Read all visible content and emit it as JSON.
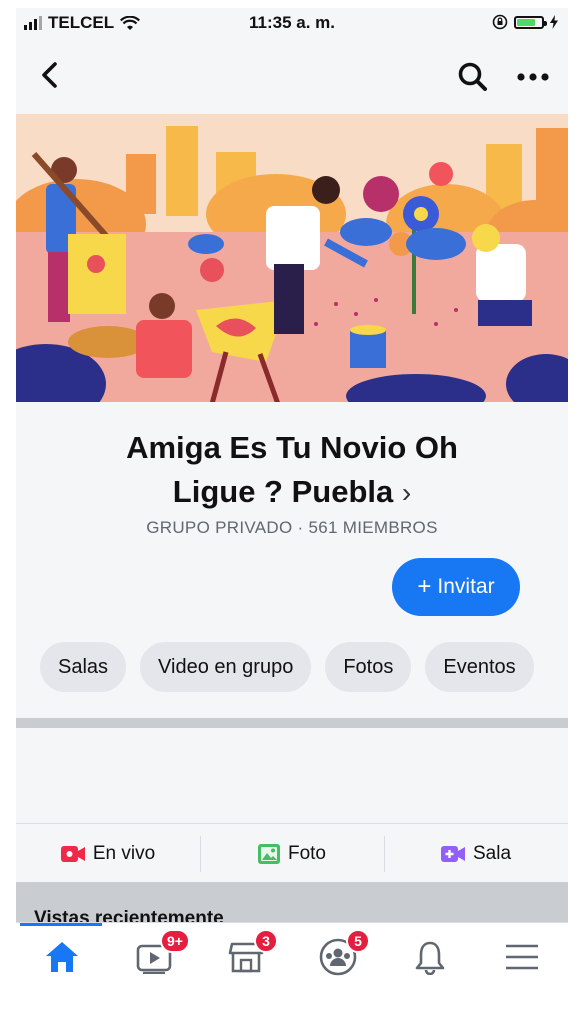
{
  "status_bar": {
    "carrier": "TELCEL",
    "time": "11:35 a. m."
  },
  "nav": {
    "back_icon": "chevron-left-icon",
    "search_icon": "search-icon",
    "more_icon": "more-icon"
  },
  "group": {
    "name_line1": "Amiga Es Tu Novio Oh",
    "name_line2": "Ligue ? Puebla",
    "chevron": "›",
    "meta": "GRUPO PRIVADO · 561 MIEMBROS"
  },
  "invite": {
    "plus": "+",
    "label": "Invitar"
  },
  "chips": [
    {
      "label": "Salas"
    },
    {
      "label": "Video en grupo"
    },
    {
      "label": "Fotos"
    },
    {
      "label": "Eventos"
    }
  ],
  "actions": [
    {
      "label": "En vivo",
      "icon": "live-video-icon",
      "color": "#f02849"
    },
    {
      "label": "Foto",
      "icon": "photo-icon",
      "color": "#45bd62"
    },
    {
      "label": "Sala",
      "icon": "room-icon",
      "color": "#9360f7"
    }
  ],
  "recent": {
    "label": "Vistas recientemente"
  },
  "tabbar": [
    {
      "icon": "home-icon",
      "badge": ""
    },
    {
      "icon": "watch-icon",
      "badge": "9+"
    },
    {
      "icon": "marketplace-icon",
      "badge": "3"
    },
    {
      "icon": "groups-icon",
      "badge": "5"
    },
    {
      "icon": "bell-icon",
      "badge": ""
    },
    {
      "icon": "menu-icon",
      "badge": ""
    }
  ],
  "colors": {
    "accent": "#1877f2",
    "badge": "#e41e3f"
  }
}
